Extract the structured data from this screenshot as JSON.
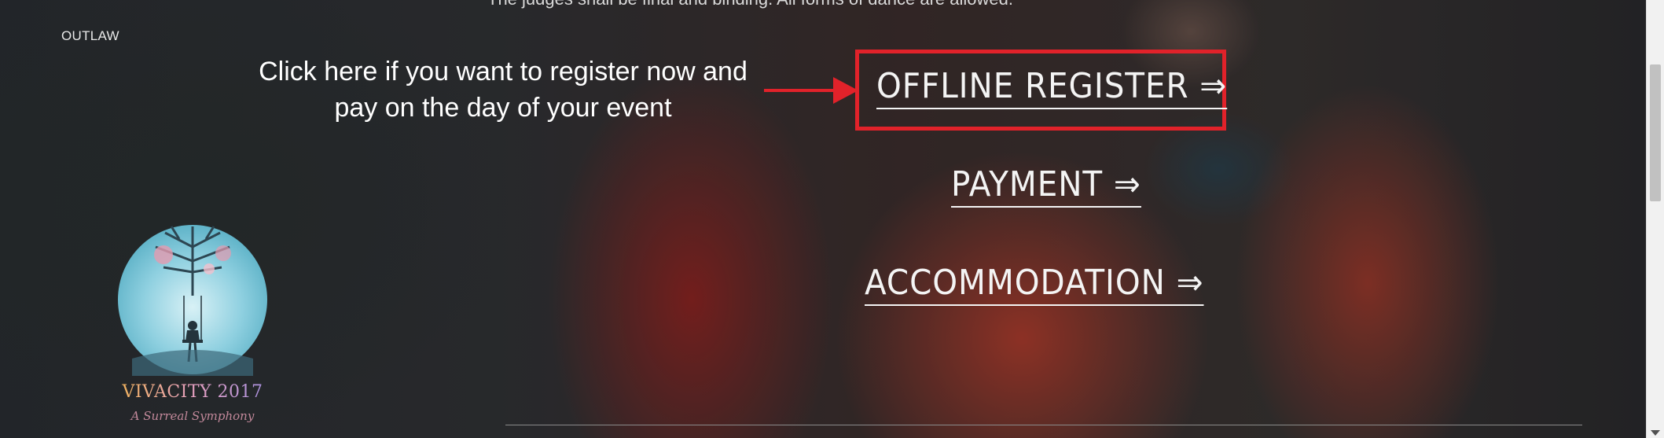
{
  "page": {
    "heading_partial": "The judges shall be final and binding. All forms of dance are allowed.",
    "category_label": "OUTLAW"
  },
  "callout": {
    "line1": "Click here if you want to register now and",
    "line2": "pay on the day of your event",
    "highlight_color": "#e1222a"
  },
  "actions": {
    "offline_register": "OFFLINE REGISTER ⇒",
    "payment": "PAYMENT ⇒",
    "accommodation": "ACCOMMODATION ⇒"
  },
  "logo": {
    "brand": "VIVACITY 2017",
    "tagline": "A Surreal Symphony"
  },
  "icons": {
    "callout_arrow": "arrow-right-icon",
    "scroll_down": "chevron-down-icon"
  }
}
